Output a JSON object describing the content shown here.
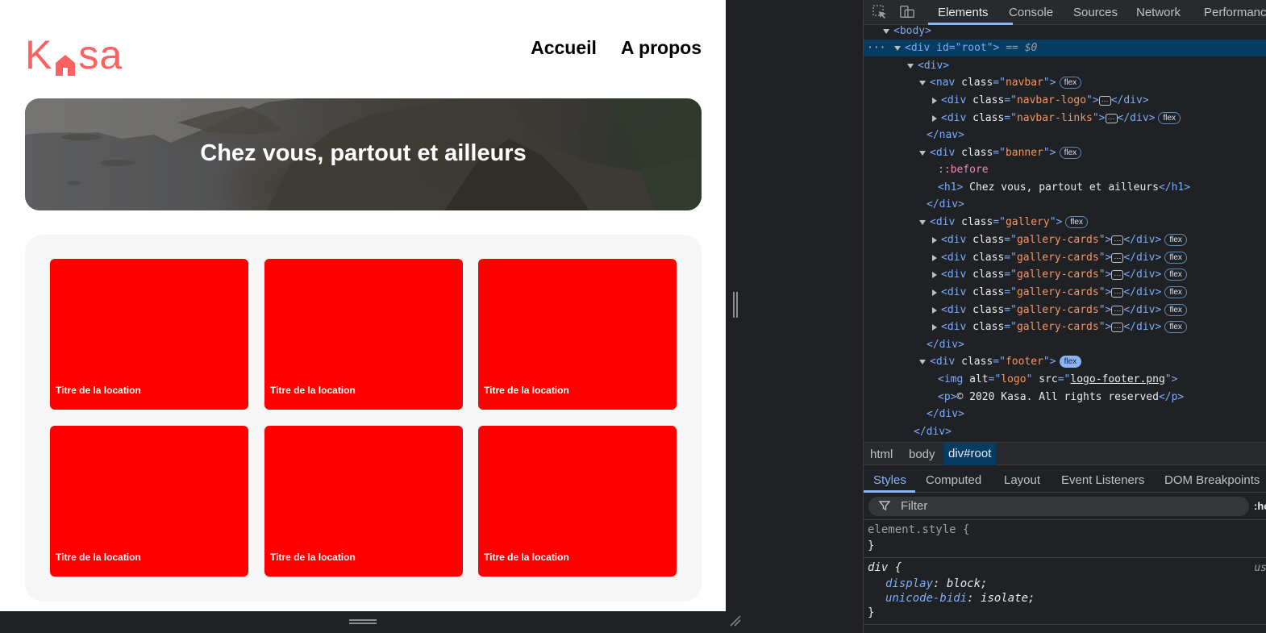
{
  "page": {
    "logo": {
      "text_k": "K",
      "text_rest": "sa",
      "color": "#ff6060"
    },
    "nav": {
      "home": "Accueil",
      "about": "A propos"
    },
    "banner": {
      "title": "Chez vous, partout et ailleurs"
    },
    "gallery": {
      "card_color": "#ff0000",
      "cards": [
        {
          "title": "Titre de la location"
        },
        {
          "title": "Titre de la location"
        },
        {
          "title": "Titre de la location"
        },
        {
          "title": "Titre de la location"
        },
        {
          "title": "Titre de la location"
        },
        {
          "title": "Titre de la location"
        }
      ]
    }
  },
  "devtools": {
    "tabs": [
      "Elements",
      "Console",
      "Sources",
      "Network",
      "Performance"
    ],
    "active_tab": "Elements",
    "tree": {
      "body": "<body>",
      "root_open": "<div id=\"root\">",
      "root_eq": "== $0",
      "div": "<div>",
      "nav_class": "navbar",
      "navbar_logo": "navbar-logo",
      "navbar_links": "navbar-links",
      "nav_close": "</nav>",
      "banner_class": "banner",
      "before": "::before",
      "h1_text": "Chez vous, partout et ailleurs",
      "div_close": "</div>",
      "gallery_class": "gallery",
      "gallery_card_class": "gallery-cards",
      "footer_class": "footer",
      "img_alt": "logo",
      "img_src": "logo-footer.png",
      "footer_p": "© 2020 Kasa. All rights reserved",
      "badge_flex": "flex"
    },
    "breadcrumbs": {
      "html": "html",
      "body": "body",
      "root": "div#root"
    },
    "sub_tabs": [
      "Styles",
      "Computed",
      "Layout",
      "Event Listeners",
      "DOM Breakpoints"
    ],
    "filter": {
      "placeholder": "Filter",
      "hov": ":ho"
    },
    "styles": {
      "element_style": "element.style {",
      "close": "}",
      "div_selector": "div {",
      "ua_label": "us",
      "props": [
        {
          "name": "display",
          "value": "block;"
        },
        {
          "name": "unicode-bidi",
          "value": "isolate;"
        }
      ]
    }
  }
}
